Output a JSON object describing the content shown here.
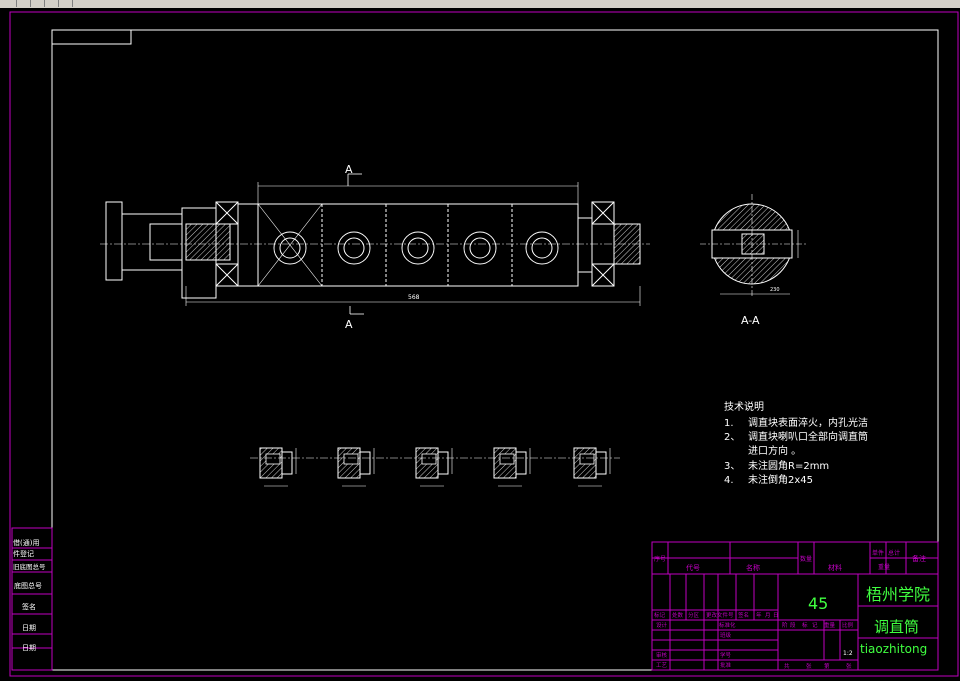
{
  "drawing": {
    "section_label_top": "A",
    "section_label_bottom": "A",
    "section_view_label": "A-A",
    "overall_dimension": "568",
    "side_dimension": "230"
  },
  "tech_notes": {
    "heading": "技术说明",
    "items": [
      {
        "num": "1.",
        "text": "调直块表面淬火，内孔光洁"
      },
      {
        "num": "2、",
        "text": "调直块喇叭口全部向调直筒"
      },
      {
        "num": "",
        "text": "进口方向 。"
      },
      {
        "num": "3、",
        "text": "未注圆角R=2mm"
      },
      {
        "num": "4.",
        "text": "未注倒角2x45"
      }
    ]
  },
  "left_strip": [
    "借(通)用",
    "件登记",
    "旧底图总号",
    "底图总号",
    "签名",
    "日期",
    "日期"
  ],
  "title_block": {
    "header": {
      "seq": "序号",
      "code": "代号",
      "name": "名称",
      "qty": "数量",
      "material": "材料",
      "unit_weight": "单件",
      "total_weight": "总计",
      "weight": "重量",
      "remarks": "备注"
    },
    "material_value": "45",
    "school": "梧州学院",
    "drawing_title": "调直筒",
    "drawing_code": "tiaozhitong",
    "scale": "1:2",
    "row_labels": [
      "标记",
      "处数",
      "分区",
      "更改文件号",
      "签名",
      "年",
      "月",
      "日"
    ],
    "stage_labels": [
      "阶",
      "段",
      "标",
      "记",
      "重量",
      "比例"
    ],
    "sign_labels": {
      "design": "设计",
      "std": "标准化",
      "review": "审核",
      "process": "工艺",
      "check": "班级",
      "approve": "批准",
      "student_id": "学号"
    },
    "sheet_labels": [
      "共",
      "张",
      "第",
      "张"
    ]
  },
  "colors": {
    "frame": "#c000c0",
    "line": "#ffffff",
    "text": "#ffffff",
    "green": "#40ff40"
  }
}
